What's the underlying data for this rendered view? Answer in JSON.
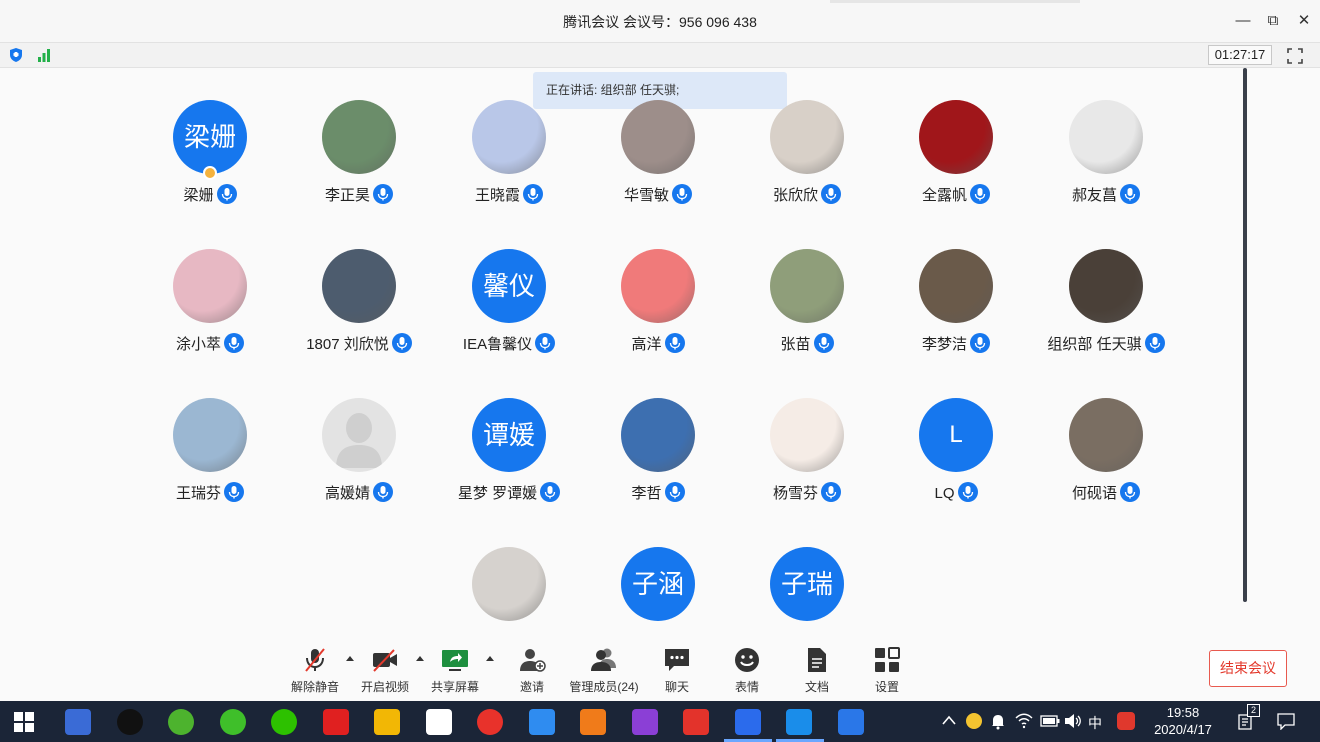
{
  "window": {
    "title": "腾讯会议 会议号：956 096 438",
    "minimize": "—",
    "restore": "⧉",
    "close": "✕"
  },
  "status": {
    "timer": "01:27:17"
  },
  "speaking": "正在讲话: 组织部 任天骐;",
  "participants": [
    {
      "name": "梁姗",
      "avatar_text": "梁姗",
      "avatar_type": "text",
      "host": true
    },
    {
      "name": "李正昊",
      "avatar_type": "photo",
      "color": "#6b8d6a"
    },
    {
      "name": "王晓霞",
      "avatar_type": "photo",
      "color": "#b9c7e8"
    },
    {
      "name": "华雪敏",
      "avatar_type": "photo",
      "color": "#9d8e8a"
    },
    {
      "name": "张欣欣",
      "avatar_type": "photo",
      "color": "#d8d0c8"
    },
    {
      "name": "全露帆",
      "avatar_type": "photo",
      "color": "#a0161a"
    },
    {
      "name": "郝友菖",
      "avatar_type": "photo",
      "color": "#e8e8e8"
    },
    {
      "name": "涂小萃",
      "avatar_type": "photo",
      "color": "#e7b8c3"
    },
    {
      "name": "1807 刘欣悦",
      "avatar_type": "photo",
      "color": "#4d5c6e"
    },
    {
      "name": "IEA鲁馨仪",
      "avatar_text": "馨仪",
      "avatar_type": "text"
    },
    {
      "name": "高洋",
      "avatar_type": "photo",
      "color": "#f07a7a"
    },
    {
      "name": "张苗",
      "avatar_type": "photo",
      "color": "#8f9e7a"
    },
    {
      "name": "李梦洁",
      "avatar_type": "photo",
      "color": "#6a5a4a"
    },
    {
      "name": "组织部 任天骐",
      "avatar_type": "photo",
      "color": "#4a4038"
    },
    {
      "name": "王瑞芬",
      "avatar_type": "photo",
      "color": "#9bb7d2"
    },
    {
      "name": "高媛婧",
      "avatar_type": "default",
      "color": "#e3e3e3"
    },
    {
      "name": "星梦 罗谭媛",
      "avatar_text": "谭媛",
      "avatar_type": "text"
    },
    {
      "name": "李哲",
      "avatar_type": "photo",
      "color": "#3d6fb0"
    },
    {
      "name": "杨雪芬",
      "avatar_type": "photo",
      "color": "#f5ece6"
    },
    {
      "name": "LQ",
      "avatar_text": "L",
      "avatar_type": "text"
    },
    {
      "name": "何砚语",
      "avatar_type": "photo",
      "color": "#7a6e62"
    },
    {
      "name": "",
      "avatar_type": "photo",
      "color": "#d6d2ce"
    },
    {
      "name": "",
      "avatar_text": "子涵",
      "avatar_type": "text"
    },
    {
      "name": "",
      "avatar_text": "子瑞",
      "avatar_type": "text"
    }
  ],
  "toolbar": {
    "unmute": "解除静音",
    "video": "开启视频",
    "share": "共享屏幕",
    "invite": "邀请",
    "members": "管理成员(24)",
    "chat": "聊天",
    "emoji": "表情",
    "docs": "文档",
    "settings": "设置",
    "end": "结束会议"
  },
  "taskbar": {
    "time": "19:58",
    "date": "2020/4/17",
    "ime": "中",
    "notifications": "2"
  },
  "colors": {
    "accent": "#1677ee",
    "end_red": "#e3392c",
    "speaker_bg": "#dde8f8",
    "taskbar": "#1b2537"
  }
}
